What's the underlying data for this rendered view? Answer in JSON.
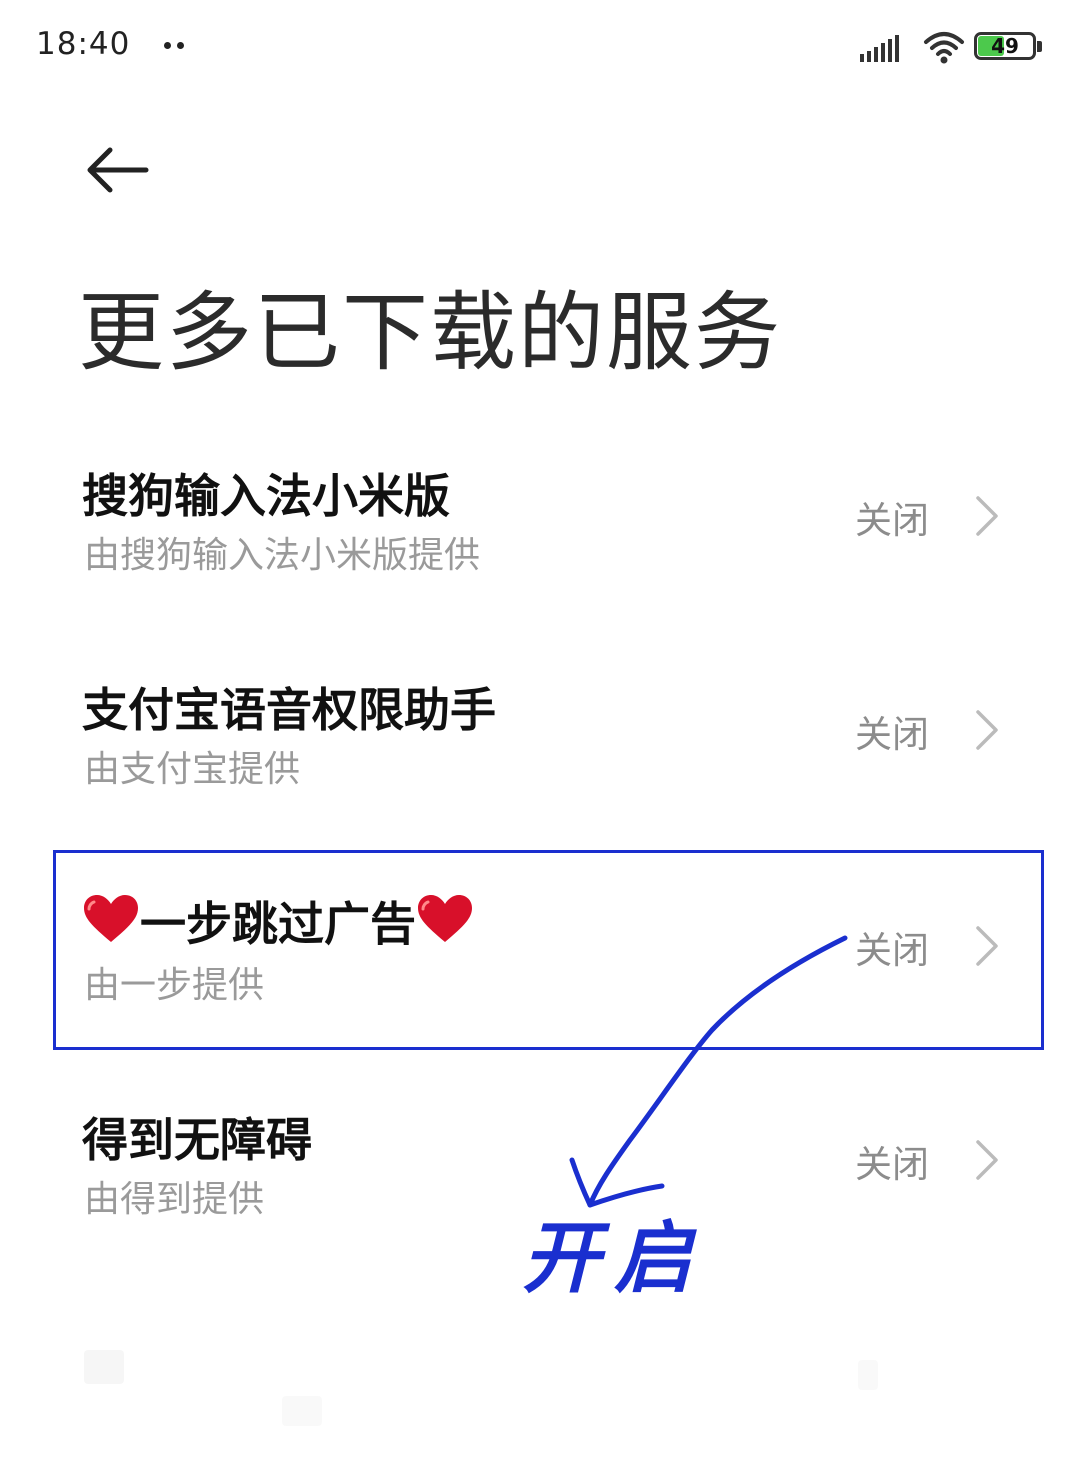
{
  "status_bar": {
    "time": "18:40",
    "battery_level": 49,
    "battery_text": "49"
  },
  "header": {
    "title": "更多已下载的服务"
  },
  "services": [
    {
      "title": "搜狗输入法小米版",
      "subtitle": "由搜狗输入法小米版提供",
      "status": "关闭"
    },
    {
      "title": "支付宝语音权限助手",
      "subtitle": "由支付宝提供",
      "status": "关闭"
    },
    {
      "title": "一步跳过广告",
      "subtitle": "由一步提供",
      "status": "关闭",
      "decor_icon": "heart-icon"
    },
    {
      "title": "得到无障碍",
      "subtitle": "由得到提供",
      "status": "关闭"
    }
  ],
  "annotation": {
    "text": "开启",
    "color": "#1a2fcf"
  },
  "colors": {
    "title": "#111111",
    "subtitle": "#9a9a9a",
    "status": "#8c8c8c",
    "battery_fill": "#4cc94c",
    "heart": "#d8102a"
  }
}
